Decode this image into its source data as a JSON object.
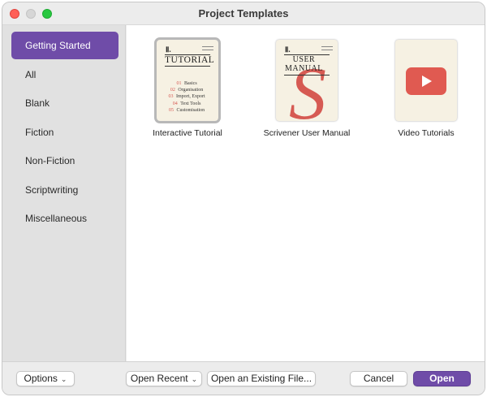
{
  "window": {
    "title": "Project Templates"
  },
  "sidebar": {
    "items": [
      {
        "label": "Getting Started"
      },
      {
        "label": "All"
      },
      {
        "label": "Blank"
      },
      {
        "label": "Fiction"
      },
      {
        "label": "Non-Fiction"
      },
      {
        "label": "Scriptwriting"
      },
      {
        "label": "Miscellaneous"
      }
    ]
  },
  "templates": [
    {
      "caption": "Interactive Tutorial",
      "thumb": {
        "logo": "Ⅱ.",
        "title": "TUTORIAL",
        "toc": [
          {
            "num": "01",
            "text": "Basics"
          },
          {
            "num": "02",
            "text": "Organisation"
          },
          {
            "num": "03",
            "text": "Import, Export"
          },
          {
            "num": "04",
            "text": "Text Tools"
          },
          {
            "num": "05",
            "text": "Customisation"
          }
        ]
      }
    },
    {
      "caption": "Scrivener User Manual",
      "thumb": {
        "logo": "Ⅱ.",
        "title_line1": "USER",
        "title_line2": "MANUAL",
        "letter": "S"
      }
    },
    {
      "caption": "Video Tutorials",
      "thumb": {
        "icon": "play-icon"
      }
    }
  ],
  "footer": {
    "options_label": "Options",
    "open_recent_label": "Open Recent",
    "open_existing_label": "Open an Existing File...",
    "cancel_label": "Cancel",
    "open_label": "Open"
  },
  "colors": {
    "accent": "#6f4ca8",
    "red": "#d65a53"
  }
}
